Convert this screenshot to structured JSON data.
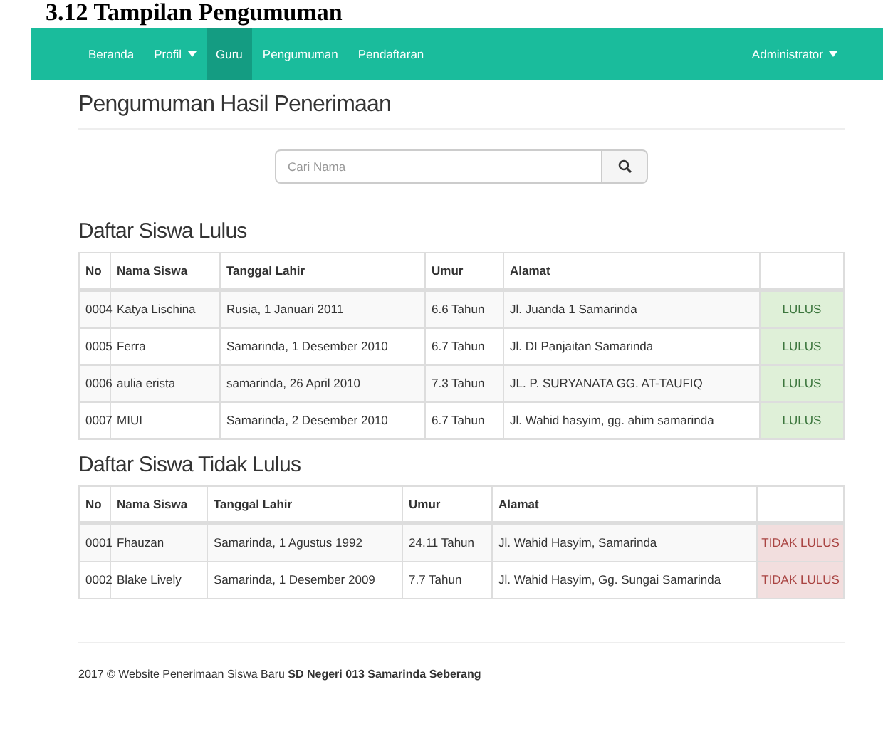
{
  "document_heading": "3.12 Tampilan Pengumuman",
  "navbar": {
    "items": [
      {
        "label": "Beranda",
        "selected": false,
        "dropdown": false
      },
      {
        "label": "Profil",
        "selected": false,
        "dropdown": true
      },
      {
        "label": "Guru",
        "selected": true,
        "dropdown": false
      },
      {
        "label": "Pengumuman",
        "selected": false,
        "dropdown": false
      },
      {
        "label": "Pendaftaran",
        "selected": false,
        "dropdown": false
      }
    ],
    "user": {
      "label": "Administrator",
      "dropdown": true
    }
  },
  "page_title": "Pengumuman Hasil Penerimaan",
  "search": {
    "placeholder": "Cari Nama"
  },
  "tables": [
    {
      "title": "Daftar Siswa Lulus",
      "columns": [
        "No",
        "Nama Siswa",
        "Tanggal Lahir",
        "Umur",
        "Alamat"
      ],
      "rows": [
        {
          "no": "0004",
          "name": "Katya Lischina",
          "birth": "Rusia, 1 Januari 2011",
          "age": "6.6 Tahun",
          "address": "Jl. Juanda 1 Samarinda",
          "status": "LULUS",
          "kind": "pass"
        },
        {
          "no": "0005",
          "name": "Ferra",
          "birth": "Samarinda, 1 Desember 2010",
          "age": "6.7 Tahun",
          "address": "Jl. DI Panjaitan Samarinda",
          "status": "LULUS",
          "kind": "pass"
        },
        {
          "no": "0006",
          "name": "aulia erista",
          "birth": "samarinda, 26 April 2010",
          "age": "7.3 Tahun",
          "address": "JL. P. SURYANATA GG. AT-TAUFIQ",
          "status": "LULUS",
          "kind": "pass"
        },
        {
          "no": "0007",
          "name": "MIUI",
          "birth": "Samarinda, 2 Desember 2010",
          "age": "6.7 Tahun",
          "address": "Jl. Wahid hasyim, gg. ahim samarinda",
          "status": "LULUS",
          "kind": "pass"
        }
      ]
    },
    {
      "title": "Daftar Siswa Tidak Lulus",
      "columns": [
        "No",
        "Nama Siswa",
        "Tanggal Lahir",
        "Umur",
        "Alamat"
      ],
      "rows": [
        {
          "no": "0001",
          "name": "Fhauzan",
          "birth": "Samarinda, 1 Agustus 1992",
          "age": "24.11 Tahun",
          "address": "Jl. Wahid Hasyim, Samarinda",
          "status": "TIDAK LULUS",
          "kind": "fail"
        },
        {
          "no": "0002",
          "name": "Blake Lively",
          "birth": "Samarinda, 1 Desember 2009",
          "age": "7.7 Tahun",
          "address": "Jl. Wahid Hasyim, Gg. Sungai Samarinda",
          "status": "TIDAK LULUS",
          "kind": "fail"
        }
      ]
    }
  ],
  "footer": "2017 © Website Penerimaan Siswa Baru **SD Negeri 013 Samarinda Seberang**"
}
